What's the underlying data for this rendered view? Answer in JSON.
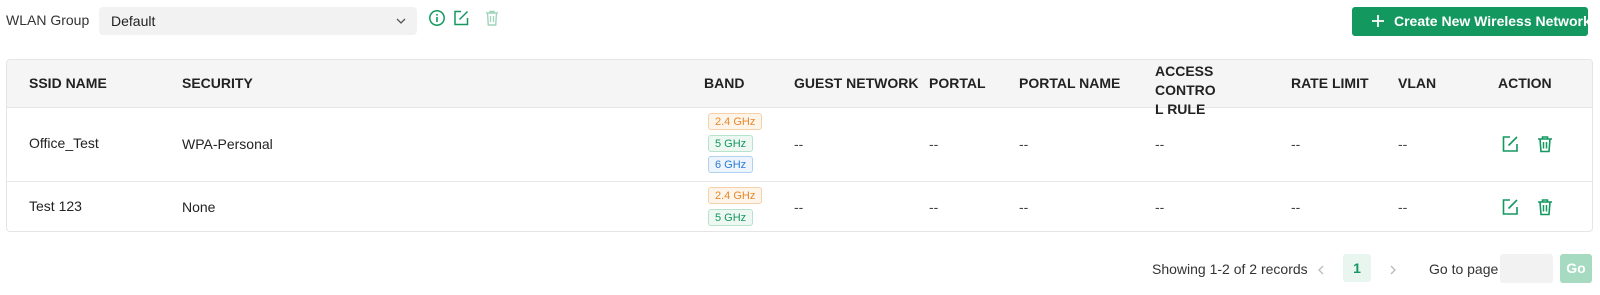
{
  "toolbar": {
    "wlan_group_label": "WLAN Group",
    "wlan_group_value": "Default",
    "create_button_label": "Create New Wireless Network",
    "icons": [
      "info-icon",
      "edit-icon",
      "delete-icon"
    ]
  },
  "table": {
    "headers": {
      "ssid_name": "SSID NAME",
      "security": "SECURITY",
      "band": "BAND",
      "guest_network": "GUEST NETWORK",
      "portal": "PORTAL",
      "portal_name": "PORTAL NAME",
      "access_control_rule_line1": "ACCESS CONTRO",
      "access_control_rule_line2": "L RULE",
      "rate_limit": "RATE LIMIT",
      "vlan": "VLAN",
      "action": "ACTION"
    },
    "rows": [
      {
        "ssid_name": "Office_Test",
        "security": "WPA-Personal",
        "bands": [
          "2.4 GHz",
          "5 GHz",
          "6 GHz"
        ],
        "guest_network": "--",
        "portal": "--",
        "portal_name": "--",
        "access_control_rule": "--",
        "rate_limit": "--",
        "vlan": "--"
      },
      {
        "ssid_name": "Test 123",
        "security": "None",
        "bands": [
          "2.4 GHz",
          "5 GHz"
        ],
        "guest_network": "--",
        "portal": "--",
        "portal_name": "--",
        "access_control_rule": "--",
        "rate_limit": "--",
        "vlan": "--"
      }
    ]
  },
  "pagination": {
    "records_text": "Showing 1-2 of 2 records",
    "current_page": "1",
    "goto_label": "Go to page",
    "goto_value": "",
    "go_button_label": "Go"
  },
  "colors": {
    "accent": "#13985f",
    "band_2_4": "#e8872b",
    "band_5": "#13985f",
    "band_6": "#2b7bd6"
  }
}
